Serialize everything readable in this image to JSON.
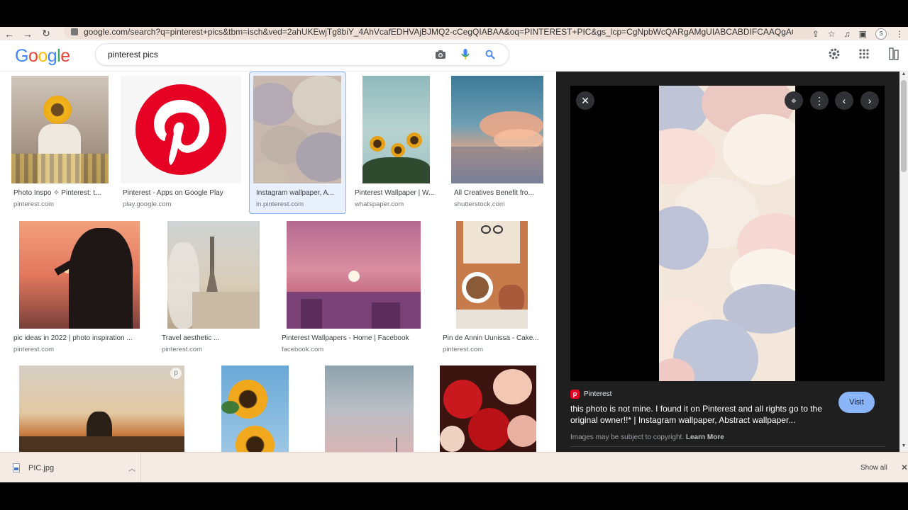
{
  "browser": {
    "url": "google.com/search?q=pinterest+pics&tbm=isch&ved=2ahUKEwjTg8biY_4AhVcafEDHVAjBJMQ2-cCegQIABAA&oq=PINTEREST+PIC&gs_lcp=CgNpbWcQARgAMgUIABCABDIFCAAQgAQyBQgA...",
    "profile_initial": "S"
  },
  "google": {
    "logo_letters": [
      "G",
      "o",
      "o",
      "g",
      "l",
      "e"
    ],
    "logo_colors": [
      "#4285f4",
      "#ea4335",
      "#fbbc05",
      "#4285f4",
      "#34a853",
      "#ea4335"
    ],
    "query": "pinterest pics"
  },
  "results": [
    {
      "title": "Photo Inspo ✧ Pinterest: t...",
      "source": "pinterest.com"
    },
    {
      "title": "Pinterest - Apps on Google Play",
      "source": "play.google.com"
    },
    {
      "title": "Instagram wallpaper, A...",
      "source": "in.pinterest.com"
    },
    {
      "title": "Pinterest Wallpaper | W...",
      "source": "whatspaper.com"
    },
    {
      "title": "All Creatives Benefit fro...",
      "source": "shutterstock.com"
    },
    {
      "title": "pic ideas in 2022 | photo inspiration ...",
      "source": "pinterest.com"
    },
    {
      "title": "Travel aesthetic ...",
      "source": "pinterest.com"
    },
    {
      "title": "Pinterest Wallpapers - Home | Facebook",
      "source": "facebook.com"
    },
    {
      "title": "Pin de Annin Uunissa - Cake...",
      "source": "pinterest.com"
    }
  ],
  "panel": {
    "source_name": "Pinterest",
    "title": "this photo is not mine. I found it on Pinterest and all rights go to the original owner!!* | Instagram wallpaper, Abstract wallpaper...",
    "visit_label": "Visit",
    "copyright_text": "Images may be subject to copyright.",
    "learn_more": "Learn More"
  },
  "downloads": {
    "file_name": "PIC.jpg",
    "show_all": "Show all"
  },
  "colors": {
    "accent": "#8ab4f8",
    "pinterest_red": "#e60023",
    "panel_bg": "#1f1f1f"
  }
}
